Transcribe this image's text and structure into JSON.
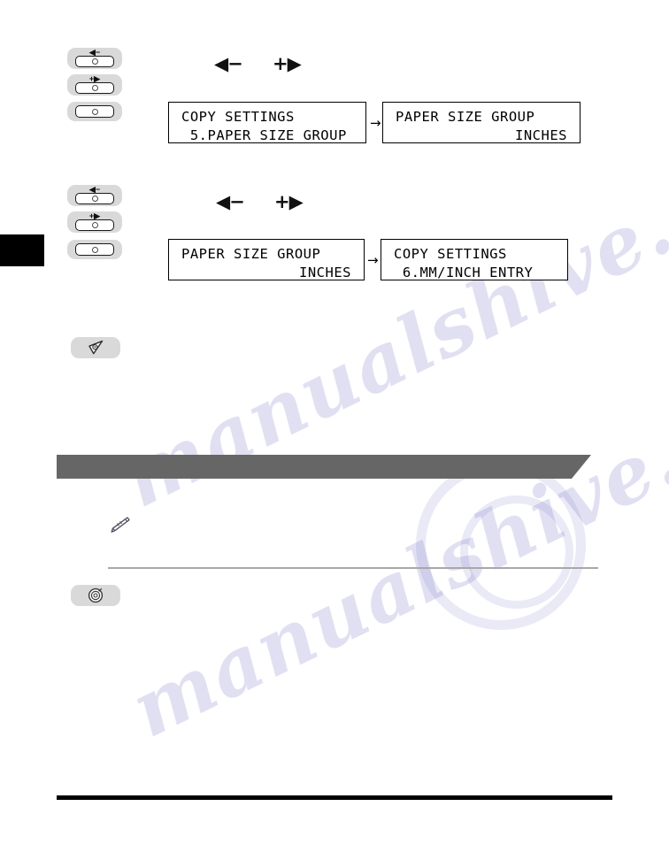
{
  "document": {
    "type": "scanned-manual-page",
    "watermark": "manualshive.com"
  },
  "colors": {
    "key_body": "#d9d9d9",
    "banner": "#666666",
    "page_tab": "#000000",
    "rule_light": "#a8a8a8",
    "rule_heavy": "#000000",
    "watermark": "#7a78c8"
  },
  "step_one": {
    "keys": [
      {
        "name": "left-minus-key",
        "glyph": "◀−",
        "has_label": true
      },
      {
        "name": "plus-right-key",
        "glyph": "+▶",
        "has_label": true
      },
      {
        "name": "set-key",
        "glyph": "",
        "has_label": false
      }
    ],
    "legend": {
      "left": "◀−",
      "right": "+▶"
    },
    "lcd_before": {
      "line1": "COPY SETTINGS",
      "line2": " 5.PAPER SIZE GROUP"
    },
    "flow_arrow": "→",
    "lcd_after": {
      "line1": "PAPER SIZE GROUP",
      "line2": "INCHES"
    }
  },
  "step_two": {
    "keys": [
      {
        "name": "left-minus-key",
        "glyph": "◀−",
        "has_label": true
      },
      {
        "name": "plus-right-key",
        "glyph": "+▶",
        "has_label": true
      },
      {
        "name": "set-key",
        "glyph": "",
        "has_label": false
      }
    ],
    "legend": {
      "left": "◀−",
      "right": "+▶"
    },
    "lcd_before": {
      "line1": "PAPER SIZE GROUP",
      "line2": "INCHES"
    },
    "flow_arrow": "→",
    "lcd_after": {
      "line1": "COPY SETTINGS",
      "line2": " 6.MM/INCH ENTRY"
    }
  },
  "notes": {
    "caution_icon": "caution-triangle-icon",
    "pencil_icon": "pencil-note-icon",
    "stop-reset_icon": "stop-reset-icon"
  }
}
